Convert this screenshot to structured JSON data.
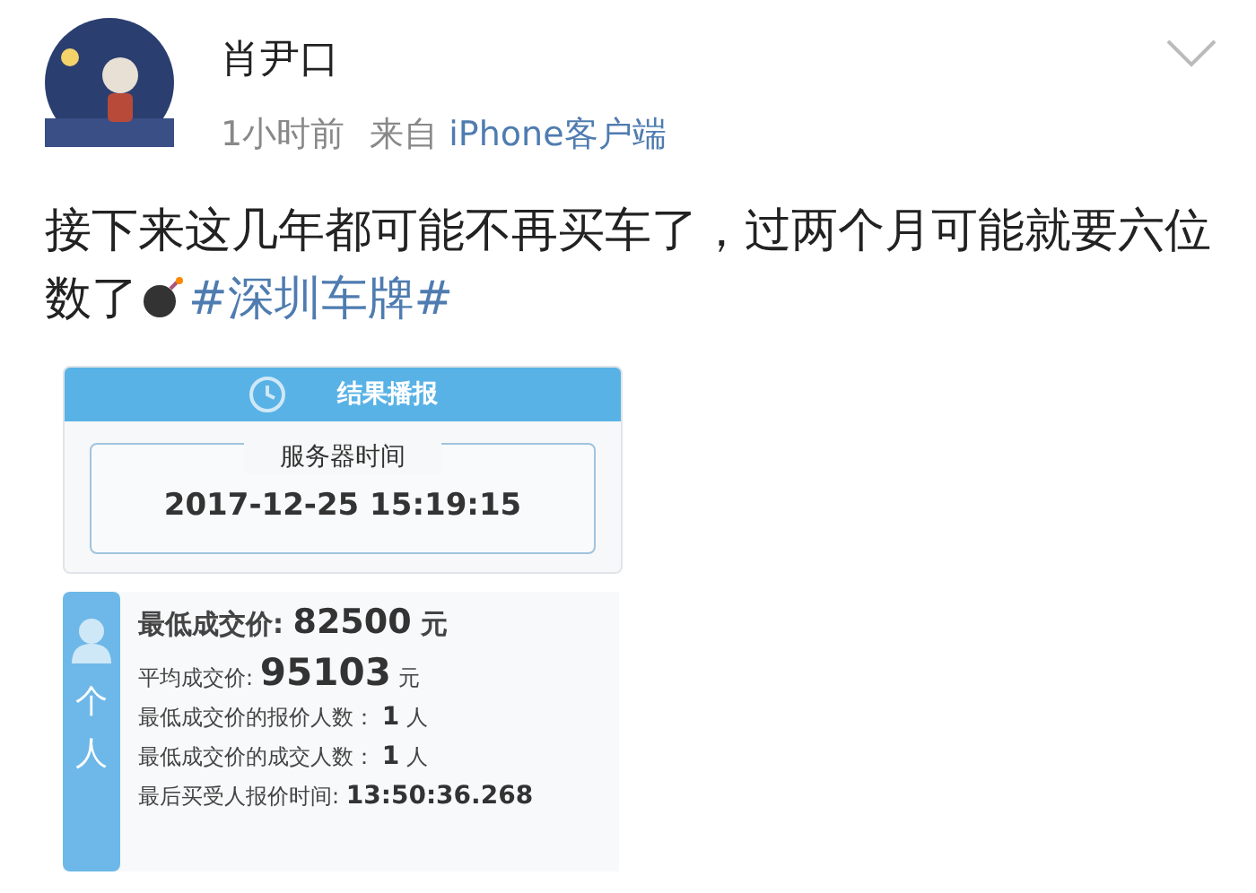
{
  "post": {
    "author": "肖尹口",
    "time": "1小时前",
    "source_prefix": "来自",
    "source": "iPhone客户端",
    "text": "接下来这几年都可能不再买车了，过两个月可能就要六位数了",
    "hashtag": "#深圳车牌#"
  },
  "result_card": {
    "title": "结果播报",
    "server_label": "服务器时间",
    "server_time": "2017-12-25 15:19:15"
  },
  "stats_card": {
    "side_label": "个人",
    "rows": [
      {
        "kind": "headline",
        "label": "最低成交价:",
        "value": "82500",
        "unit": "元"
      },
      {
        "kind": "large",
        "label": "平均成交价:",
        "value": "95103",
        "unit": "元"
      },
      {
        "kind": "plain",
        "label": "最低成交价的报价人数：",
        "value": "1",
        "unit": "人"
      },
      {
        "kind": "plain",
        "label": "最低成交价的成交人数：",
        "value": "1",
        "unit": "人"
      },
      {
        "kind": "plain",
        "label": "最后买受人报价时间:",
        "value": "13:50:36.268"
      }
    ]
  }
}
